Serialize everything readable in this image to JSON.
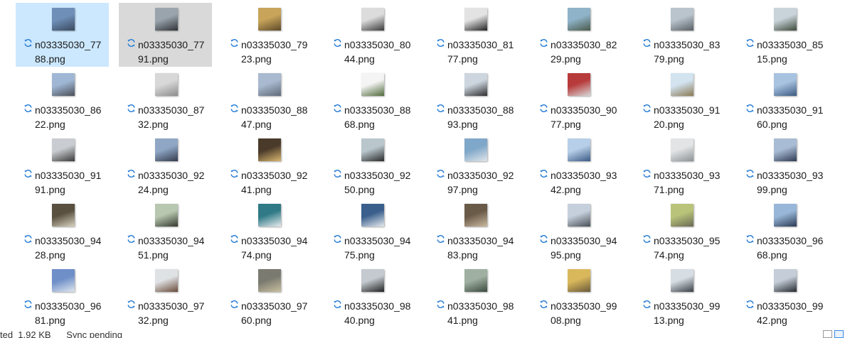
{
  "files": [
    {
      "name": "n03335030_7788.png",
      "line1": "n03335030_77",
      "line2": "88.png",
      "state": "selected",
      "c1": "#6f8fb8",
      "c2": "#3a4a5e"
    },
    {
      "name": "n03335030_7791.png",
      "line1": "n03335030_77",
      "line2": "91.png",
      "state": "hover",
      "c1": "#9aa4ac",
      "c2": "#2f3338"
    },
    {
      "name": "n03335030_7923.png",
      "line1": "n03335030_79",
      "line2": "23.png",
      "state": "",
      "c1": "#c7a45a",
      "c2": "#5e4a2a"
    },
    {
      "name": "n03335030_8044.png",
      "line1": "n03335030_80",
      "line2": "44.png",
      "state": "",
      "c1": "#dcdcdc",
      "c2": "#3b3b3b"
    },
    {
      "name": "n03335030_8177.png",
      "line1": "n03335030_81",
      "line2": "77.png",
      "state": "",
      "c1": "#e3e3e3",
      "c2": "#222222"
    },
    {
      "name": "n03335030_8229.png",
      "line1": "n03335030_82",
      "line2": "29.png",
      "state": "",
      "c1": "#8fb3c9",
      "c2": "#4a5a4a"
    },
    {
      "name": "n03335030_8379.png",
      "line1": "n03335030_83",
      "line2": "79.png",
      "state": "",
      "c1": "#b9c4cc",
      "c2": "#5a5f66"
    },
    {
      "name": "n03335030_8515.png",
      "line1": "n03335030_85",
      "line2": "15.png",
      "state": "",
      "c1": "#c9d3da",
      "c2": "#3d4a3a"
    },
    {
      "name": "n03335030_8622.png",
      "line1": "n03335030_86",
      "line2": "22.png",
      "state": "",
      "c1": "#9fb7d4",
      "c2": "#4b4f58"
    },
    {
      "name": "n03335030_8732.png",
      "line1": "n03335030_87",
      "line2": "32.png",
      "state": "",
      "c1": "#d8d8d8",
      "c2": "#8c8c8c"
    },
    {
      "name": "n03335030_8847.png",
      "line1": "n03335030_88",
      "line2": "47.png",
      "state": "",
      "c1": "#a9b9cf",
      "c2": "#5f6a78"
    },
    {
      "name": "n03335030_8868.png",
      "line1": "n03335030_88",
      "line2": "68.png",
      "state": "",
      "c1": "#f4f4f4",
      "c2": "#4f6a3a"
    },
    {
      "name": "n03335030_8893.png",
      "line1": "n03335030_88",
      "line2": "93.png",
      "state": "",
      "c1": "#cdd6df",
      "c2": "#2e2e2e"
    },
    {
      "name": "n03335030_9077.png",
      "line1": "n03335030_90",
      "line2": "77.png",
      "state": "",
      "c1": "#b83b3b",
      "c2": "#d8d8d8"
    },
    {
      "name": "n03335030_9120.png",
      "line1": "n03335030_91",
      "line2": "20.png",
      "state": "",
      "c1": "#d3e3f0",
      "c2": "#8a7a55"
    },
    {
      "name": "n03335030_9160.png",
      "line1": "n03335030_91",
      "line2": "60.png",
      "state": "",
      "c1": "#a8c3e0",
      "c2": "#3c5a82"
    },
    {
      "name": "n03335030_9191.png",
      "line1": "n03335030_91",
      "line2": "91.png",
      "state": "",
      "c1": "#c9ccd0",
      "c2": "#3a3a3a"
    },
    {
      "name": "n03335030_9224.png",
      "line1": "n03335030_92",
      "line2": "24.png",
      "state": "",
      "c1": "#8fa6c4",
      "c2": "#343b4c"
    },
    {
      "name": "n03335030_9241.png",
      "line1": "n03335030_92",
      "line2": "41.png",
      "state": "",
      "c1": "#4a3a2a",
      "c2": "#d9b770"
    },
    {
      "name": "n03335030_9250.png",
      "line1": "n03335030_92",
      "line2": "50.png",
      "state": "",
      "c1": "#b9c7cd",
      "c2": "#2a2a2a"
    },
    {
      "name": "n03335030_9297.png",
      "line1": "n03335030_92",
      "line2": "97.png",
      "state": "",
      "c1": "#7fa7c9",
      "c2": "#e0e6ea"
    },
    {
      "name": "n03335030_9342.png",
      "line1": "n03335030_93",
      "line2": "42.png",
      "state": "",
      "c1": "#b7cfe8",
      "c2": "#3b5a86"
    },
    {
      "name": "n03335030_9371.png",
      "line1": "n03335030_93",
      "line2": "71.png",
      "state": "",
      "c1": "#e2e4e5",
      "c2": "#8c9296"
    },
    {
      "name": "n03335030_9399.png",
      "line1": "n03335030_93",
      "line2": "99.png",
      "state": "",
      "c1": "#a9bcd5",
      "c2": "#2e3b52"
    },
    {
      "name": "n03335030_9428.png",
      "line1": "n03335030_94",
      "line2": "28.png",
      "state": "",
      "c1": "#5a5040",
      "c2": "#d8d2c0"
    },
    {
      "name": "n03335030_9451.png",
      "line1": "n03335030_94",
      "line2": "51.png",
      "state": "",
      "c1": "#b8c7b0",
      "c2": "#353a2e"
    },
    {
      "name": "n03335030_9474.png",
      "line1": "n03335030_94",
      "line2": "74.png",
      "state": "",
      "c1": "#2f7a86",
      "c2": "#e8ecee"
    },
    {
      "name": "n03335030_9475.png",
      "line1": "n03335030_94",
      "line2": "75.png",
      "state": "",
      "c1": "#3a5f8c",
      "c2": "#e6eaee"
    },
    {
      "name": "n03335030_9483.png",
      "line1": "n03335030_94",
      "line2": "83.png",
      "state": "",
      "c1": "#6a5a48",
      "c2": "#c9b9a0"
    },
    {
      "name": "n03335030_9495.png",
      "line1": "n03335030_94",
      "line2": "95.png",
      "state": "",
      "c1": "#c5d0dc",
      "c2": "#4a4f58"
    },
    {
      "name": "n03335030_9574.png",
      "line1": "n03335030_95",
      "line2": "74.png",
      "state": "",
      "c1": "#b9c47a",
      "c2": "#6a6a55"
    },
    {
      "name": "n03335030_9668.png",
      "line1": "n03335030_96",
      "line2": "68.png",
      "state": "",
      "c1": "#98b6d8",
      "c2": "#2b3a52"
    },
    {
      "name": "n03335030_9681.png",
      "line1": "n03335030_96",
      "line2": "81.png",
      "state": "",
      "c1": "#6f8fc8",
      "c2": "#dfe6ef"
    },
    {
      "name": "n03335030_9732.png",
      "line1": "n03335030_97",
      "line2": "32.png",
      "state": "",
      "c1": "#dfe2e4",
      "c2": "#6a4a3a"
    },
    {
      "name": "n03335030_9760.png",
      "line1": "n03335030_97",
      "line2": "60.png",
      "state": "",
      "c1": "#7a7a70",
      "c2": "#c9c0a0"
    },
    {
      "name": "n03335030_9840.png",
      "line1": "n03335030_98",
      "line2": "40.png",
      "state": "",
      "c1": "#c4cacf",
      "c2": "#222222"
    },
    {
      "name": "n03335030_9841.png",
      "line1": "n03335030_98",
      "line2": "41.png",
      "state": "",
      "c1": "#9fb0a2",
      "c2": "#3a4a3e"
    },
    {
      "name": "n03335030_9908.png",
      "line1": "n03335030_99",
      "line2": "08.png",
      "state": "",
      "c1": "#d9b85c",
      "c2": "#6a5a3a"
    },
    {
      "name": "n03335030_9913.png",
      "line1": "n03335030_99",
      "line2": "13.png",
      "state": "",
      "c1": "#d6dde3",
      "c2": "#3a3f46"
    },
    {
      "name": "n03335030_9942.png",
      "line1": "n03335030_99",
      "line2": "42.png",
      "state": "",
      "c1": "#c5ced8",
      "c2": "#262a30"
    }
  ],
  "status": {
    "text": "ted  1.92 KB      Sync pending"
  },
  "colors": {
    "sync_icon": "#2b7fd6",
    "selected_bg": "#cce8ff",
    "hover_bg": "#d9d9d9"
  },
  "icons": {
    "file_state": "sync-pending-icon",
    "view_details": "details-view-icon",
    "view_large": "large-icons-view-icon"
  }
}
